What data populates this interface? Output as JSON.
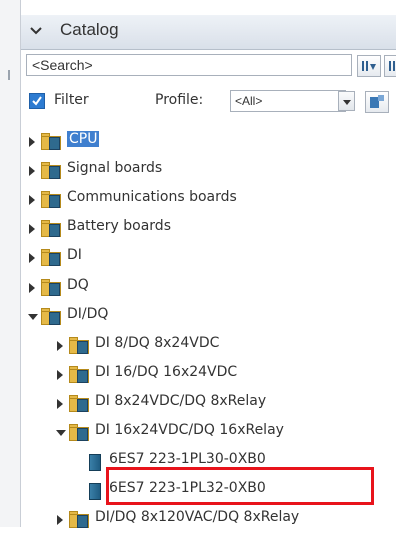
{
  "panel": {
    "title": "Catalog"
  },
  "search": {
    "placeholder": "<Search>"
  },
  "filter": {
    "label": "Filter",
    "checked": true,
    "profile_label": "Profile:",
    "profile_value": "<All>"
  },
  "tree": [
    {
      "label": "CPU",
      "depth": 0,
      "state": "collapsed",
      "selected": true,
      "kind": "folder"
    },
    {
      "label": "Signal boards",
      "depth": 0,
      "state": "collapsed",
      "kind": "folder"
    },
    {
      "label": "Communications boards",
      "depth": 0,
      "state": "collapsed",
      "kind": "folder"
    },
    {
      "label": "Battery boards",
      "depth": 0,
      "state": "collapsed",
      "kind": "folder"
    },
    {
      "label": "DI",
      "depth": 0,
      "state": "collapsed",
      "kind": "folder"
    },
    {
      "label": "DQ",
      "depth": 0,
      "state": "collapsed",
      "kind": "folder"
    },
    {
      "label": "DI/DQ",
      "depth": 0,
      "state": "expanded",
      "kind": "folder"
    },
    {
      "label": "DI 8/DQ 8x24VDC",
      "depth": 1,
      "state": "collapsed",
      "kind": "folder"
    },
    {
      "label": "DI 16/DQ 16x24VDC",
      "depth": 1,
      "state": "collapsed",
      "kind": "folder"
    },
    {
      "label": "DI 8x24VDC/DQ 8xRelay",
      "depth": 1,
      "state": "collapsed",
      "kind": "folder"
    },
    {
      "label": "DI 16x24VDC/DQ 16xRelay",
      "depth": 1,
      "state": "expanded",
      "kind": "folder"
    },
    {
      "label": "6ES7 223-1PL30-0XB0",
      "depth": 2,
      "state": "leaf",
      "kind": "module"
    },
    {
      "label": "6ES7 223-1PL32-0XB0",
      "depth": 2,
      "state": "leaf",
      "kind": "module",
      "highlighted": true
    },
    {
      "label": "DI/DQ 8x120VAC/DQ 8xRelay",
      "depth": 1,
      "state": "collapsed",
      "kind": "folder"
    }
  ]
}
